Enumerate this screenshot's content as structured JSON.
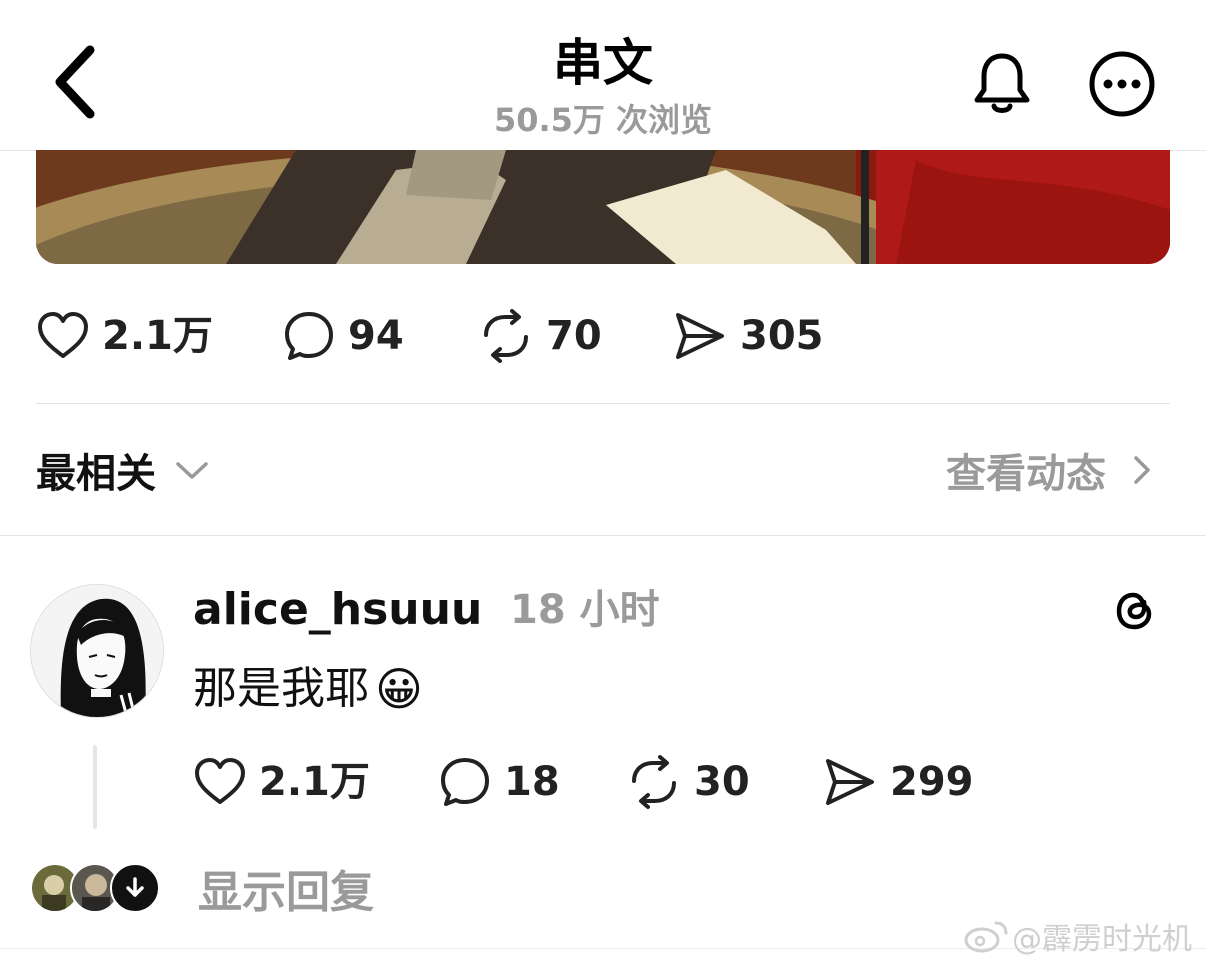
{
  "header": {
    "title": "串文",
    "subtitle": "50.5万 次浏览"
  },
  "post": {
    "actions": {
      "likes": "2.1万",
      "comments": "94",
      "reposts": "70",
      "shares": "305"
    }
  },
  "replies_header": {
    "sort_label": "最相关",
    "activity_label": "查看动态"
  },
  "reply": {
    "username": "alice_hsuuu",
    "time": "18 小时",
    "text": "那是我耶",
    "emoji": "😀",
    "actions": {
      "likes": "2.1万",
      "comments": "18",
      "reposts": "30",
      "shares": "299"
    },
    "show_replies_label": "显示回复"
  },
  "watermark": "@霹雳时光机",
  "colors": {
    "muted": "#9a9a9a",
    "divider": "#e3e3e3"
  }
}
